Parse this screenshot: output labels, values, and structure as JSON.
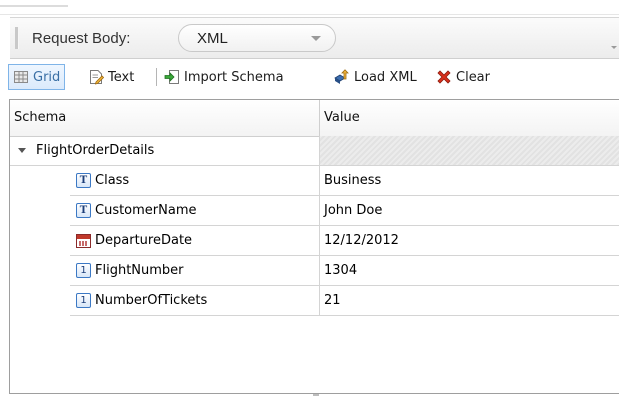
{
  "request": {
    "label": "Request Body:",
    "body_type": "XML"
  },
  "toolbar": {
    "grid_label": "Grid",
    "text_label": "Text",
    "import_label": "Import Schema",
    "load_label": "Load XML",
    "clear_label": "Clear"
  },
  "icons": {
    "grid": "grid-icon",
    "text": "text-edit-icon",
    "import": "import-arrow-icon",
    "load": "load-xml-icon",
    "clear": "red-x-icon",
    "string": "text-type-icon",
    "date": "calendar-icon",
    "number": "number-type-icon"
  },
  "grid": {
    "headers": {
      "schema": "Schema",
      "value": "Value"
    },
    "root": {
      "name": "FlightOrderDetails"
    },
    "rows": [
      {
        "type_glyph": "T",
        "name": "Class",
        "value": "Business"
      },
      {
        "type_glyph": "T",
        "name": "CustomerName",
        "value": "John Doe"
      },
      {
        "type_glyph": "",
        "name": "DepartureDate",
        "value": "12/12/2012"
      },
      {
        "type_glyph": "1",
        "name": "FlightNumber",
        "value": "1304"
      },
      {
        "type_glyph": "1",
        "name": "NumberOfTickets",
        "value": "21"
      }
    ]
  },
  "colors": {
    "accent": "#3a6fa5",
    "selected_border": "#7fb4e8",
    "clear_red": "#d9301c"
  }
}
